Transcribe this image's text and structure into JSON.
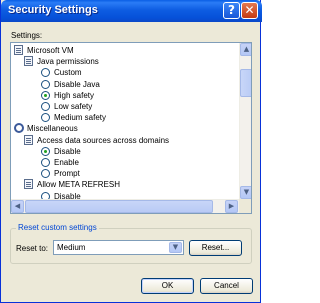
{
  "window": {
    "title": "Security Settings",
    "help_label": "?",
    "close_label": "✕"
  },
  "settings_label": "Settings:",
  "tree": [
    {
      "icon": "settings-page-icon",
      "label": "Microsoft VM",
      "indent": 0,
      "kind": "category"
    },
    {
      "icon": "settings-page-icon",
      "label": "Java permissions",
      "indent": 1,
      "kind": "category"
    },
    {
      "label": "Custom",
      "indent": 2,
      "kind": "radio",
      "checked": false
    },
    {
      "label": "Disable Java",
      "indent": 2,
      "kind": "radio",
      "checked": false
    },
    {
      "label": "High safety",
      "indent": 2,
      "kind": "radio",
      "checked": true
    },
    {
      "label": "Low safety",
      "indent": 2,
      "kind": "radio",
      "checked": false
    },
    {
      "label": "Medium safety",
      "indent": 2,
      "kind": "radio",
      "checked": false
    },
    {
      "icon": "gear-icon",
      "label": "Miscellaneous",
      "indent": 0,
      "kind": "category"
    },
    {
      "icon": "settings-page-icon",
      "label": "Access data sources across domains",
      "indent": 1,
      "kind": "category"
    },
    {
      "label": "Disable",
      "indent": 2,
      "kind": "radio",
      "checked": true
    },
    {
      "label": "Enable",
      "indent": 2,
      "kind": "radio",
      "checked": false
    },
    {
      "label": "Prompt",
      "indent": 2,
      "kind": "radio",
      "checked": false
    },
    {
      "icon": "settings-page-icon",
      "label": "Allow META REFRESH",
      "indent": 1,
      "kind": "category"
    },
    {
      "label": "Disable",
      "indent": 2,
      "kind": "radio",
      "checked": false
    }
  ],
  "scrollbars": {
    "up_arrow": "▲",
    "down_arrow": "▼",
    "left_arrow": "◀",
    "right_arrow": "▶"
  },
  "reset_group": {
    "title": "Reset custom settings",
    "reset_to_label": "Reset to:",
    "selected_value": "Medium",
    "dropdown_arrow": "▼",
    "reset_button": "Reset..."
  },
  "footer": {
    "ok_button": "OK",
    "cancel_button": "Cancel"
  },
  "colors": {
    "title_bar": "#0a5ee5",
    "dialog_bg": "#ece9d8",
    "group_title": "#0046d5",
    "radio_dot": "#21a121"
  }
}
